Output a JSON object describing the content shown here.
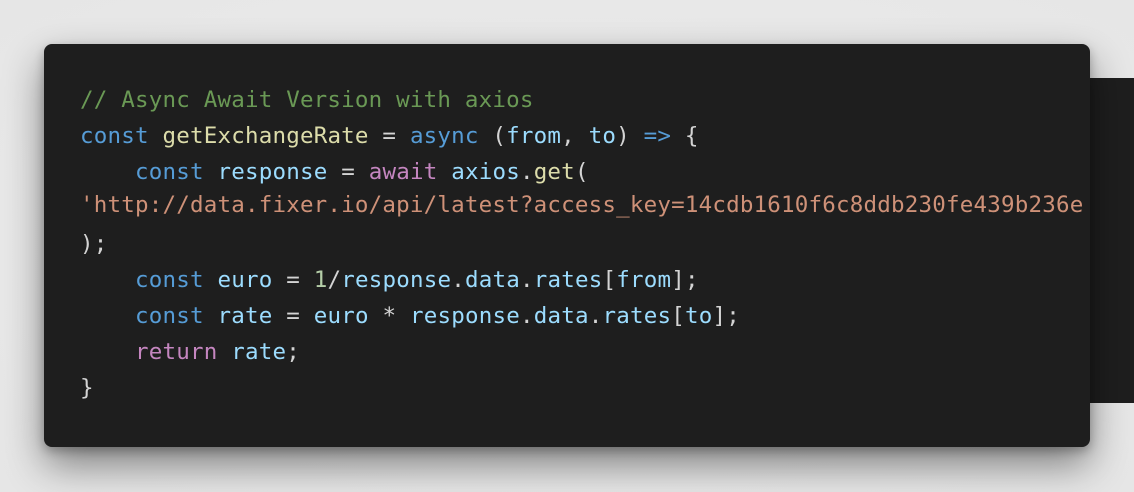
{
  "code": {
    "comment": "// Async Await Version with axios",
    "line2": {
      "kw_const": "const",
      "fn_name": "getExchangeRate",
      "eq": " = ",
      "kw_async": "async",
      "open": " (",
      "param_from": "from",
      "comma": ", ",
      "param_to": "to",
      "close": ") ",
      "arrow": "=>",
      "brace": " {"
    },
    "line3": {
      "indent": "    ",
      "kw_const": "const",
      "var_response": "response",
      "eq": " = ",
      "kw_await": "await",
      "obj_axios": "axios",
      "dot": ".",
      "fn_get": "get",
      "paren": "("
    },
    "line4": {
      "string": "'http://data.fixer.io/api/latest?access_key=14cdb1610f6c8ddb230fe439b236e"
    },
    "line5": {
      "text": ");"
    },
    "line6": {
      "indent": "    ",
      "kw_const": "const",
      "var_euro": "euro",
      "eq": " = ",
      "num": "1",
      "slash": "/",
      "var_response": "response",
      "dot1": ".",
      "var_data": "data",
      "dot2": ".",
      "var_rates": "rates",
      "bracket_open": "[",
      "var_from": "from",
      "bracket_close": "];"
    },
    "line7": {
      "indent": "    ",
      "kw_const": "const",
      "var_rate": "rate",
      "eq": " = ",
      "var_euro": "euro",
      "star": " * ",
      "var_response": "response",
      "dot1": ".",
      "var_data": "data",
      "dot2": ".",
      "var_rates": "rates",
      "bracket_open": "[",
      "var_to": "to",
      "bracket_close": "];"
    },
    "line8": {
      "indent": "    ",
      "kw_return": "return",
      "var_rate": "rate",
      "semi": ";"
    },
    "line9": {
      "text": "}"
    }
  },
  "colors": {
    "background": "#1e1e1e",
    "comment": "#6a9955",
    "keyword": "#569cd6",
    "function": "#dcdcaa",
    "variable": "#9cdcfe",
    "control": "#c586c0",
    "number": "#b5cea8",
    "string": "#ce9178"
  }
}
